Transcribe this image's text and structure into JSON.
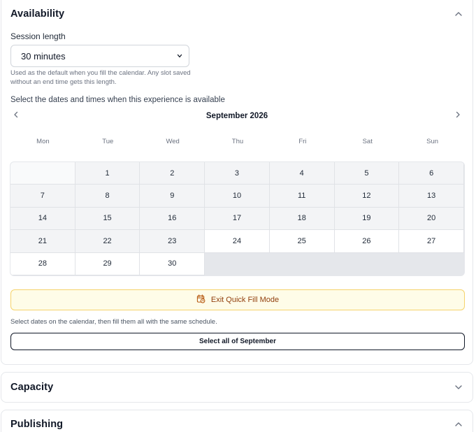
{
  "availability": {
    "title": "Availability",
    "session_length_label": "Session length",
    "session_length_value": "30 minutes",
    "session_length_help": "Used as the default when you fill the calendar. Any slot saved without an end time gets this length.",
    "instruction": "Select the dates and times when this experience is available",
    "calendar": {
      "month_title": "September 2026",
      "weekdays": [
        "Mon",
        "Tue",
        "Wed",
        "Thu",
        "Fri",
        "Sat",
        "Sun"
      ],
      "leading_empty": 1,
      "days": [
        {
          "label": "1",
          "selected": true
        },
        {
          "label": "2",
          "selected": true
        },
        {
          "label": "3",
          "selected": true
        },
        {
          "label": "4",
          "selected": true
        },
        {
          "label": "5",
          "selected": true
        },
        {
          "label": "6",
          "selected": true
        },
        {
          "label": "7",
          "selected": true
        },
        {
          "label": "8",
          "selected": true
        },
        {
          "label": "9",
          "selected": true
        },
        {
          "label": "10",
          "selected": true
        },
        {
          "label": "11",
          "selected": true
        },
        {
          "label": "12",
          "selected": true
        },
        {
          "label": "13",
          "selected": true
        },
        {
          "label": "14",
          "selected": true
        },
        {
          "label": "15",
          "selected": true
        },
        {
          "label": "16",
          "selected": true
        },
        {
          "label": "17",
          "selected": true
        },
        {
          "label": "18",
          "selected": true
        },
        {
          "label": "19",
          "selected": true
        },
        {
          "label": "20",
          "selected": true
        },
        {
          "label": "21",
          "selected": true
        },
        {
          "label": "22",
          "selected": true
        },
        {
          "label": "23",
          "selected": true
        },
        {
          "label": "24",
          "selected": false
        },
        {
          "label": "25",
          "selected": false
        },
        {
          "label": "26",
          "selected": false
        },
        {
          "label": "27",
          "selected": false
        },
        {
          "label": "28",
          "selected": false
        },
        {
          "label": "29",
          "selected": false
        },
        {
          "label": "30",
          "selected": false
        }
      ],
      "trailing_empty": 4
    },
    "exit_quick_fill_label": "Exit Quick Fill Mode",
    "fill_note": "Select dates on the calendar, then fill them all with the same schedule.",
    "select_all_label": "Select all of September"
  },
  "capacity": {
    "title": "Capacity"
  },
  "publishing": {
    "title": "Publishing"
  },
  "icons": {
    "collapse": "chevron-up-icon",
    "expand": "chevron-down-icon",
    "prev_month": "chevron-left-icon",
    "next_month": "chevron-right-icon",
    "exit_quick_fill": "calendar-clock-icon"
  },
  "colors": {
    "selected_day_bg": "#f3f4f6",
    "exit_button_bg": "#fefce8",
    "exit_button_border": "#f5d36b",
    "exit_button_text": "#92400e"
  }
}
